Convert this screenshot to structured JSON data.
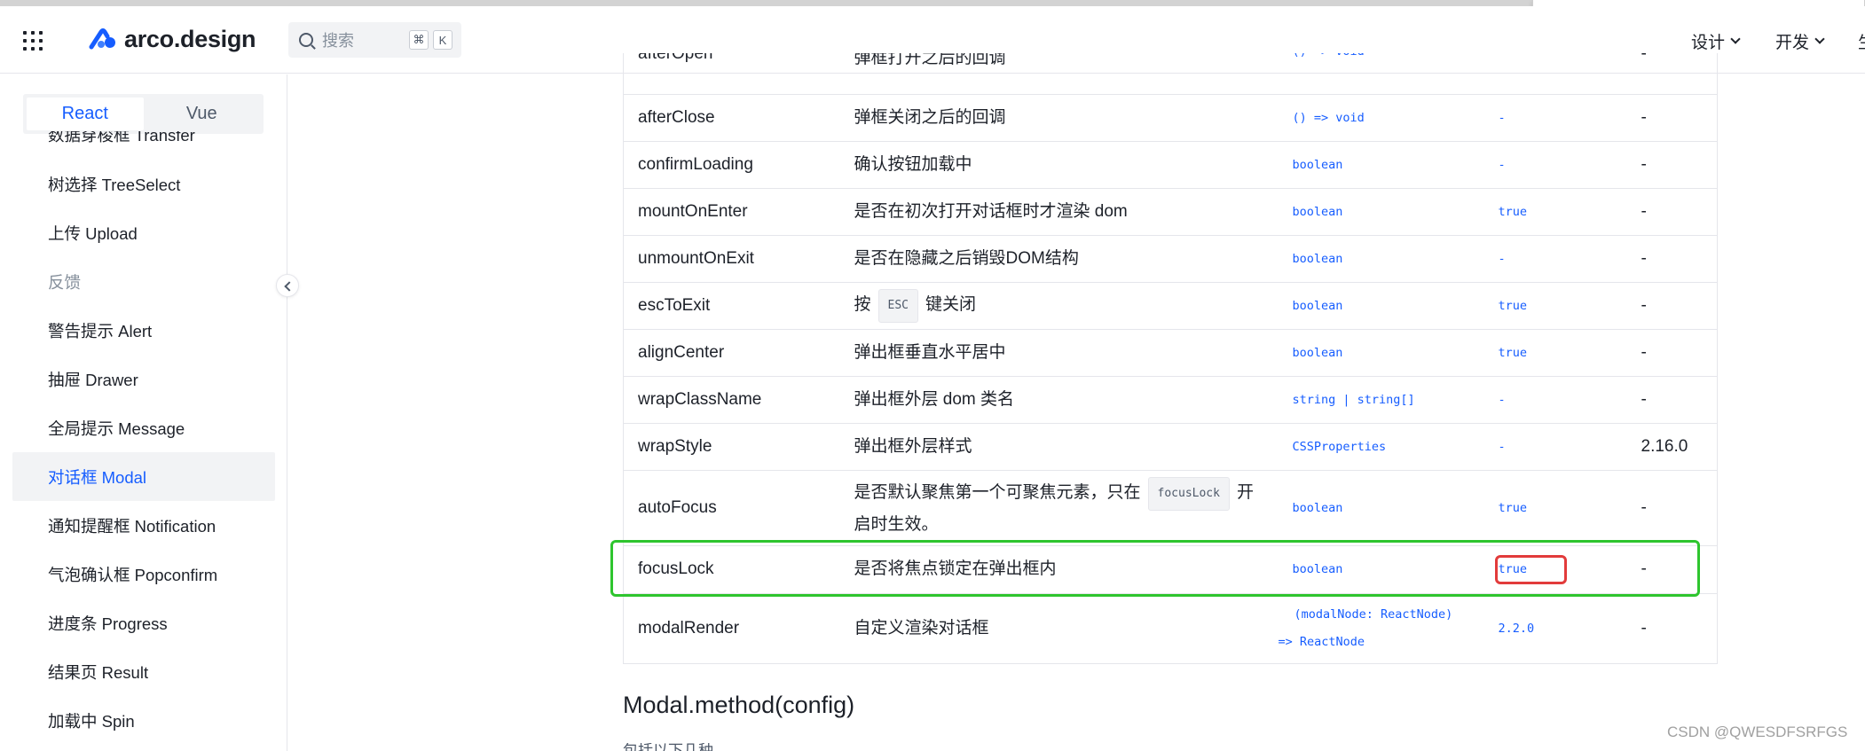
{
  "header": {
    "brand": "arco.design",
    "search_placeholder": "搜索",
    "shortcut_cmd": "⌘",
    "shortcut_key": "K",
    "nav": [
      {
        "label": "设计"
      },
      {
        "label": "开发"
      },
      {
        "label": "生"
      }
    ]
  },
  "sidebar": {
    "framework_tabs": [
      "React",
      "Vue"
    ],
    "active_framework": "React",
    "items": [
      {
        "label": "数据穿梭框 Transfer",
        "state": "cut"
      },
      {
        "label": "树选择 TreeSelect"
      },
      {
        "label": "上传 Upload"
      },
      {
        "label": "反馈",
        "state": "group"
      },
      {
        "label": "警告提示 Alert"
      },
      {
        "label": "抽屉 Drawer"
      },
      {
        "label": "全局提示 Message"
      },
      {
        "label": "对话框 Modal",
        "state": "active"
      },
      {
        "label": "通知提醒框 Notification"
      },
      {
        "label": "气泡确认框 Popconfirm"
      },
      {
        "label": "进度条 Progress"
      },
      {
        "label": "结果页 Result"
      },
      {
        "label": "加载中 Spin"
      }
    ]
  },
  "props_table": {
    "rows": [
      {
        "name": "afterOpen",
        "desc": "弹框打开之后的回调",
        "type": "() => void",
        "default": "-",
        "version": "-"
      },
      {
        "name": "afterClose",
        "desc": "弹框关闭之后的回调",
        "type": "() => void",
        "default": "-",
        "version": "-"
      },
      {
        "name": "confirmLoading",
        "desc": "确认按钮加载中",
        "type": "boolean",
        "default": "-",
        "version": "-"
      },
      {
        "name": "mountOnEnter",
        "desc": "是否在初次打开对话框时才渲染 dom",
        "type": "boolean",
        "default": "true",
        "version": "-"
      },
      {
        "name": "unmountOnExit",
        "desc": "是否在隐藏之后销毁DOM结构",
        "type": "boolean",
        "default": "-",
        "version": "-"
      },
      {
        "name": "escToExit",
        "desc_pre": "按",
        "desc_code": "ESC",
        "desc_post": "键关闭",
        "type": "boolean",
        "default": "true",
        "version": "-"
      },
      {
        "name": "alignCenter",
        "desc": "弹出框垂直水平居中",
        "type": "boolean",
        "default": "true",
        "version": "-"
      },
      {
        "name": "wrapClassName",
        "desc": "弹出框外层 dom 类名",
        "type": "string | string[]",
        "default": "-",
        "version": "-"
      },
      {
        "name": "wrapStyle",
        "desc": "弹出框外层样式",
        "type": "CSSProperties",
        "default": "-",
        "version": "2.16.0"
      },
      {
        "name": "autoFocus",
        "desc_pre": "是否默认聚焦第一个可聚焦元素，只在",
        "desc_code": "focusLock",
        "desc_post": "开启时生效。",
        "type": "boolean",
        "default": "true",
        "version": "-"
      },
      {
        "name": "focusLock",
        "desc": "是否将焦点锁定在弹出框内",
        "type": "boolean",
        "default": "true",
        "version": "-"
      },
      {
        "name": "modalRender",
        "desc": "自定义渲染对话框",
        "type_line1": "(modalNode: ReactNode)",
        "type_line2": "=> ReactNode",
        "default": "2.2.0",
        "version": "-"
      }
    ]
  },
  "section": {
    "title": "Modal.method(config)",
    "subtitle": "包括以下几种"
  },
  "watermark": "CSDN @QWESDFSRFGS",
  "colors": {
    "accent": "#165dff",
    "highlight_row": "#2ec52e",
    "highlight_cell": "#e23b3b"
  }
}
